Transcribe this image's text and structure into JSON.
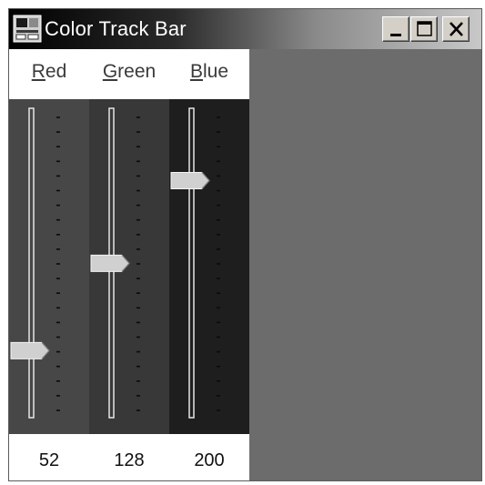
{
  "window": {
    "title": "Color Track Bar",
    "controls": {
      "minimize": "minimize-icon",
      "maximize": "maximize-icon",
      "close": "close-icon"
    }
  },
  "sliders": [
    {
      "label": "Red",
      "accel": "R",
      "rest": "ed",
      "value": "52",
      "level": 52,
      "bg": "#474747"
    },
    {
      "label": "Green",
      "accel": "G",
      "rest": "reen",
      "value": "128",
      "level": 128,
      "bg": "#383838"
    },
    {
      "label": "Blue",
      "accel": "B",
      "rest": "lue",
      "value": "200",
      "level": 200,
      "bg": "#1e1e1e"
    }
  ],
  "range": {
    "min": 0,
    "max": 255
  },
  "preview": {
    "color": "#6c6c6c"
  },
  "colors": {
    "thumb": "#d0d0d0",
    "tick": "#0a0a0a",
    "track": "#e6e6e6"
  }
}
